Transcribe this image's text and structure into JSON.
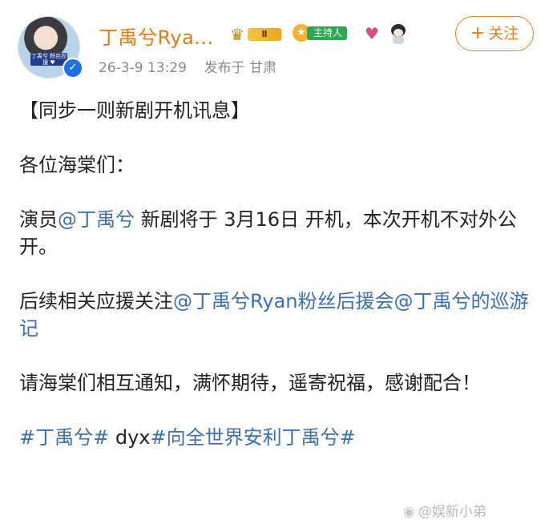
{
  "post": {
    "author": {
      "name": "丁禹兮Rya...",
      "verified": true,
      "avatar_caption": "丁禹兮 粉丝应援 ♥",
      "badges": [
        {
          "name": "crown-level-badge",
          "label": "Ⅱ"
        },
        {
          "name": "host-badge",
          "label": "主持人"
        },
        {
          "name": "heart-badge-icon"
        },
        {
          "name": "chibi-avatar-badge-icon"
        }
      ]
    },
    "timestamp": "26-3-9 13:29",
    "location_label": "发布于 甘肃",
    "follow_button": "关注",
    "follow_icon": "+",
    "body": {
      "title": "【同步一则新剧开机讯息】",
      "greeting": "各位海棠们：",
      "p1_prefix": "演员",
      "p1_mention": "@丁禹兮",
      "p1_suffix": " 新剧将于 3月16日 开机，本次开机不对外公开。",
      "p2_prefix": "后续相关应援关注",
      "p2_mention1": "@丁禹兮Ryan粉丝后援会",
      "p2_mention2": "@丁禹兮的巡游记",
      "p3": "请海棠们相互通知，满怀期待，遥寄祝福，感谢配合！",
      "hashtag1": "#丁禹兮#",
      "hashtag_text": " dyx",
      "hashtag2": "#向全世界安利丁禹兮#"
    },
    "watermark": "@娱新小弟"
  },
  "colors": {
    "username": "#e8790e",
    "link": "#3a6fb5",
    "follow_border": "#e8801a",
    "host_badge": "#2fa84f",
    "meta": "#8a8a8a"
  }
}
